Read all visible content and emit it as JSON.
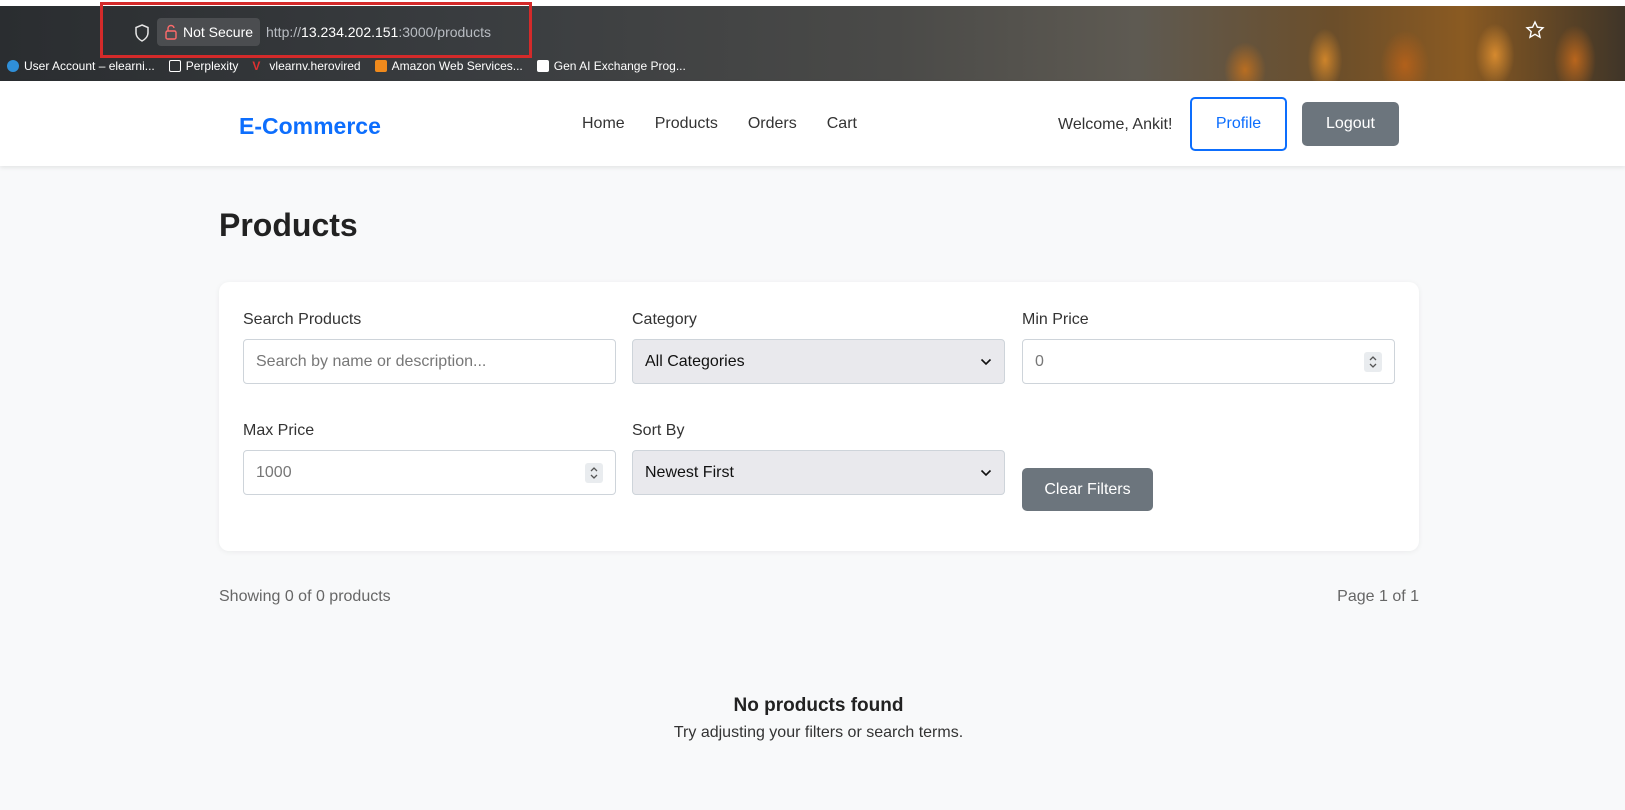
{
  "browser": {
    "security_label": "Not Secure",
    "url_scheme": "http://",
    "url_host": "13.234.202.151",
    "url_rest": ":3000/products",
    "bookmarks": [
      {
        "label": "User Account – elearni...",
        "icon": "globe-icon"
      },
      {
        "label": "Perplexity",
        "icon": "perplexity-icon"
      },
      {
        "label": "vlearnv.herovired",
        "icon": "v-icon"
      },
      {
        "label": "Amazon Web Services...",
        "icon": "aws-icon"
      },
      {
        "label": "Gen AI Exchange Prog...",
        "icon": "grid-icon"
      }
    ]
  },
  "navbar": {
    "brand": "E-Commerce",
    "links": [
      "Home",
      "Products",
      "Orders",
      "Cart"
    ],
    "welcome": "Welcome, Ankit!",
    "profile_label": "Profile",
    "logout_label": "Logout",
    "brand_color": "#0d6efd"
  },
  "page": {
    "title": "Products"
  },
  "filters": {
    "search_label": "Search Products",
    "search_placeholder": "Search by name or description...",
    "category_label": "Category",
    "category_value": "All Categories",
    "min_price_label": "Min Price",
    "min_price_placeholder": "0",
    "max_price_label": "Max Price",
    "max_price_placeholder": "1000",
    "sort_label": "Sort By",
    "sort_value": "Newest First",
    "clear_label": "Clear Filters"
  },
  "results": {
    "showing": "Showing 0 of 0 products",
    "page_info": "Page 1 of 1",
    "empty_title": "No products found",
    "empty_subtitle": "Try adjusting your filters or search terms."
  }
}
